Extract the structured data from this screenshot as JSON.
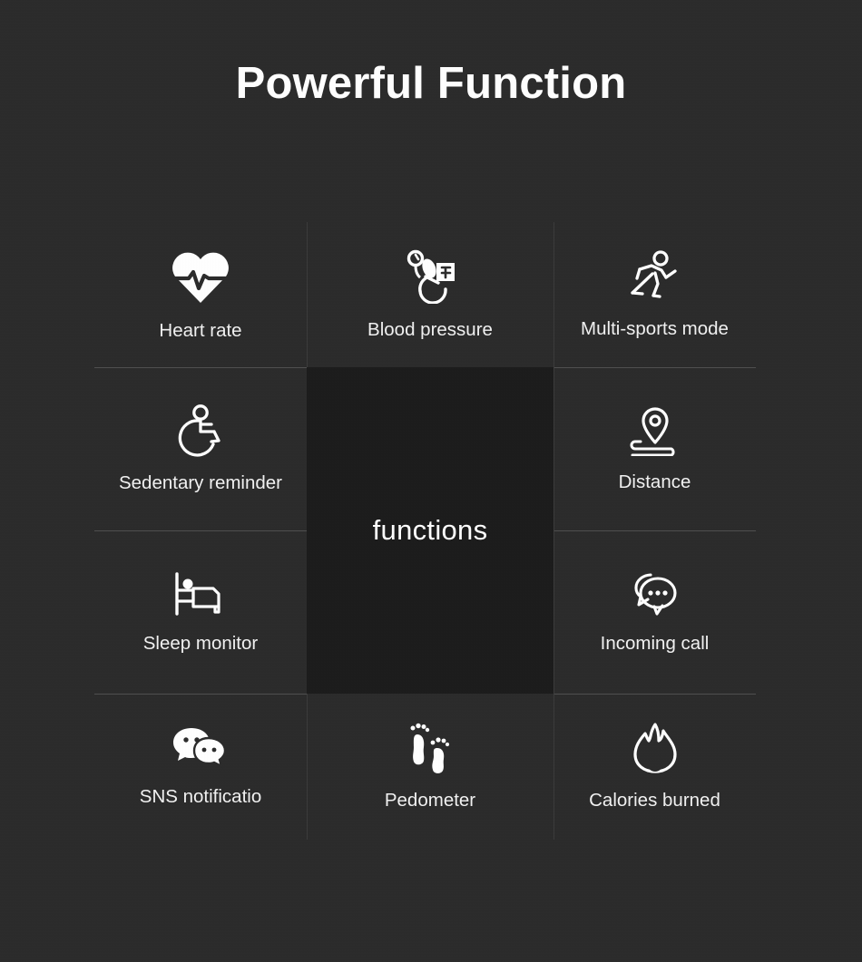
{
  "page": {
    "title": "Powerful Function",
    "background_color": "#2b2b2b",
    "panel_color": "#1c1c1c",
    "text_color": "#ffffff",
    "divider_color": "#5c5c5c"
  },
  "center": {
    "label": "functions"
  },
  "features": [
    {
      "id": "heart-rate",
      "label": "Heart rate",
      "icon": "heart-pulse-icon",
      "row": 1,
      "col": 1
    },
    {
      "id": "blood-pressure",
      "label": "Blood pressure",
      "icon": "sphygmomanometer-icon",
      "row": 1,
      "col": 2
    },
    {
      "id": "multi-sports-mode",
      "label": "Multi-sports mode",
      "icon": "running-person-icon",
      "row": 1,
      "col": 3
    },
    {
      "id": "sedentary-reminder",
      "label": "Sedentary reminder",
      "icon": "wheelchair-icon",
      "row": 2,
      "col": 1
    },
    {
      "id": "distance",
      "label": "Distance",
      "icon": "map-pin-route-icon",
      "row": 2,
      "col": 3
    },
    {
      "id": "sleep-monitor",
      "label": "Sleep monitor",
      "icon": "bed-sleep-icon",
      "row": 3,
      "col": 1
    },
    {
      "id": "incoming-call",
      "label": "Incoming call",
      "icon": "chat-bubbles-dots-icon",
      "row": 3,
      "col": 3
    },
    {
      "id": "sns-notification",
      "label": "SNS notificatio",
      "icon": "wechat-bubbles-icon",
      "row": 4,
      "col": 1
    },
    {
      "id": "pedometer",
      "label": "Pedometer",
      "icon": "footprints-icon",
      "row": 4,
      "col": 2
    },
    {
      "id": "calories-burned",
      "label": "Calories burned",
      "icon": "flame-icon",
      "row": 4,
      "col": 3
    }
  ]
}
